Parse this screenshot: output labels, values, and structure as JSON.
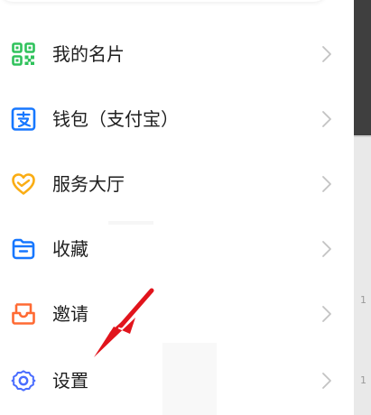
{
  "menu": {
    "items": [
      {
        "id": "card",
        "label": "我的名片",
        "icon": "qr-code-icon",
        "color": "#2fc25b"
      },
      {
        "id": "wallet",
        "label": "钱包（支付宝）",
        "icon": "alipay-wallet-icon",
        "color": "#1677ff"
      },
      {
        "id": "service",
        "label": "服务大厅",
        "icon": "heart-service-icon",
        "color": "#faad14"
      },
      {
        "id": "favorites",
        "label": "收藏",
        "icon": "folder-favorites-icon",
        "color": "#1677ff"
      },
      {
        "id": "invite",
        "label": "邀请",
        "icon": "invite-inbox-icon",
        "color": "#ff6a33"
      },
      {
        "id": "settings",
        "label": "设置",
        "icon": "gear-icon",
        "color": "#4a6dff"
      }
    ]
  },
  "colors": {
    "text": "#1e1e1e",
    "chevron": "#c3c3c3",
    "annotation_arrow": "#e1141c"
  },
  "side_digits": [
    "1",
    "1"
  ]
}
